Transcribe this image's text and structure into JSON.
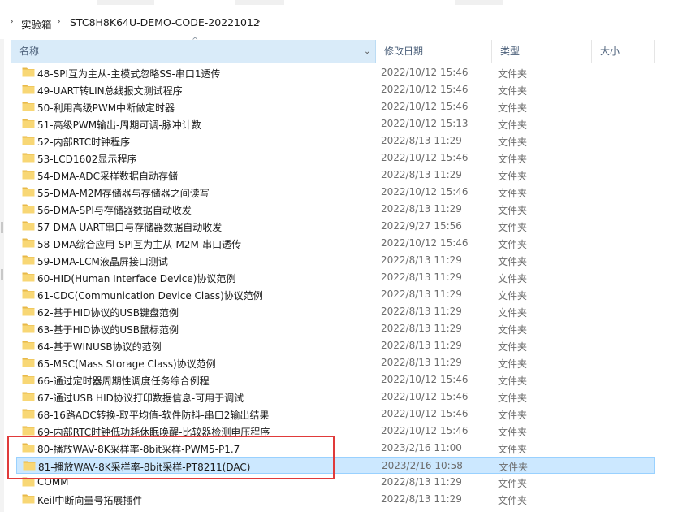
{
  "breadcrumb": {
    "segment1": "实验箱",
    "segment2": "STC8H8K64U-DEMO-CODE-20221012"
  },
  "columns": {
    "name": "名称",
    "date": "修改日期",
    "type": "类型",
    "size": "大小"
  },
  "files": [
    {
      "name": "48-SPI互为主从-主模式忽略SS-串口1透传",
      "date": "2022/10/12 15:46",
      "type": "文件夹"
    },
    {
      "name": "49-UART转LIN总线报文测试程序",
      "date": "2022/10/12 15:46",
      "type": "文件夹"
    },
    {
      "name": "50-利用高级PWM中断做定时器",
      "date": "2022/10/12 15:46",
      "type": "文件夹"
    },
    {
      "name": "51-高级PWM输出-周期可调-脉冲计数",
      "date": "2022/10/12 15:13",
      "type": "文件夹"
    },
    {
      "name": "52-内部RTC时钟程序",
      "date": "2022/8/13 11:29",
      "type": "文件夹"
    },
    {
      "name": "53-LCD1602显示程序",
      "date": "2022/10/12 15:46",
      "type": "文件夹"
    },
    {
      "name": "54-DMA-ADC采样数据自动存储",
      "date": "2022/8/13 11:29",
      "type": "文件夹"
    },
    {
      "name": "55-DMA-M2M存储器与存储器之间读写",
      "date": "2022/10/12 15:46",
      "type": "文件夹"
    },
    {
      "name": "56-DMA-SPI与存储器数据自动收发",
      "date": "2022/8/13 11:29",
      "type": "文件夹"
    },
    {
      "name": "57-DMA-UART串口与存储器数据自动收发",
      "date": "2022/9/27 15:56",
      "type": "文件夹"
    },
    {
      "name": "58-DMA综合应用-SPI互为主从-M2M-串口透传",
      "date": "2022/10/12 15:46",
      "type": "文件夹"
    },
    {
      "name": "59-DMA-LCM液晶屏接口测试",
      "date": "2022/8/13 11:29",
      "type": "文件夹"
    },
    {
      "name": "60-HID(Human Interface Device)协议范例",
      "date": "2022/8/13 11:29",
      "type": "文件夹"
    },
    {
      "name": "61-CDC(Communication Device Class)协议范例",
      "date": "2022/8/13 11:29",
      "type": "文件夹"
    },
    {
      "name": "62-基于HID协议的USB键盘范例",
      "date": "2022/8/13 11:29",
      "type": "文件夹"
    },
    {
      "name": "63-基于HID协议的USB鼠标范例",
      "date": "2022/8/13 11:29",
      "type": "文件夹"
    },
    {
      "name": "64-基于WINUSB协议的范例",
      "date": "2022/8/13 11:29",
      "type": "文件夹"
    },
    {
      "name": "65-MSC(Mass Storage Class)协议范例",
      "date": "2022/8/13 11:29",
      "type": "文件夹"
    },
    {
      "name": "66-通过定时器周期性调度任务综合例程",
      "date": "2022/10/12 15:46",
      "type": "文件夹"
    },
    {
      "name": "67-通过USB HID协议打印数据信息-可用于调试",
      "date": "2022/10/12 15:46",
      "type": "文件夹"
    },
    {
      "name": "68-16路ADC转换-取平均值-软件防抖-串口2输出结果",
      "date": "2022/10/12 15:46",
      "type": "文件夹"
    },
    {
      "name": "69-内部RTC时钟低功耗休眠唤醒-比较器检测电压程序",
      "date": "2022/10/12 15:46",
      "type": "文件夹"
    },
    {
      "name": "80-播放WAV-8K采样率-8bit采样-PWM5-P1.7",
      "date": "2023/2/16 11:00",
      "type": "文件夹"
    },
    {
      "name": "81-播放WAV-8K采样率-8bit采样-PT8211(DAC)",
      "date": "2023/2/16 10:58",
      "type": "文件夹",
      "selected": true
    },
    {
      "name": "COMM",
      "date": "2022/8/13 11:29",
      "type": "文件夹"
    },
    {
      "name": "Keil中断向量号拓展插件",
      "date": "2022/8/13 11:29",
      "type": "文件夹"
    }
  ],
  "colors": {
    "folder_body": "#f8d775",
    "folder_tab": "#e8b949",
    "selection": "#cce8ff",
    "highlight": "#e03a3a",
    "header_active": "#d9ebf9"
  }
}
